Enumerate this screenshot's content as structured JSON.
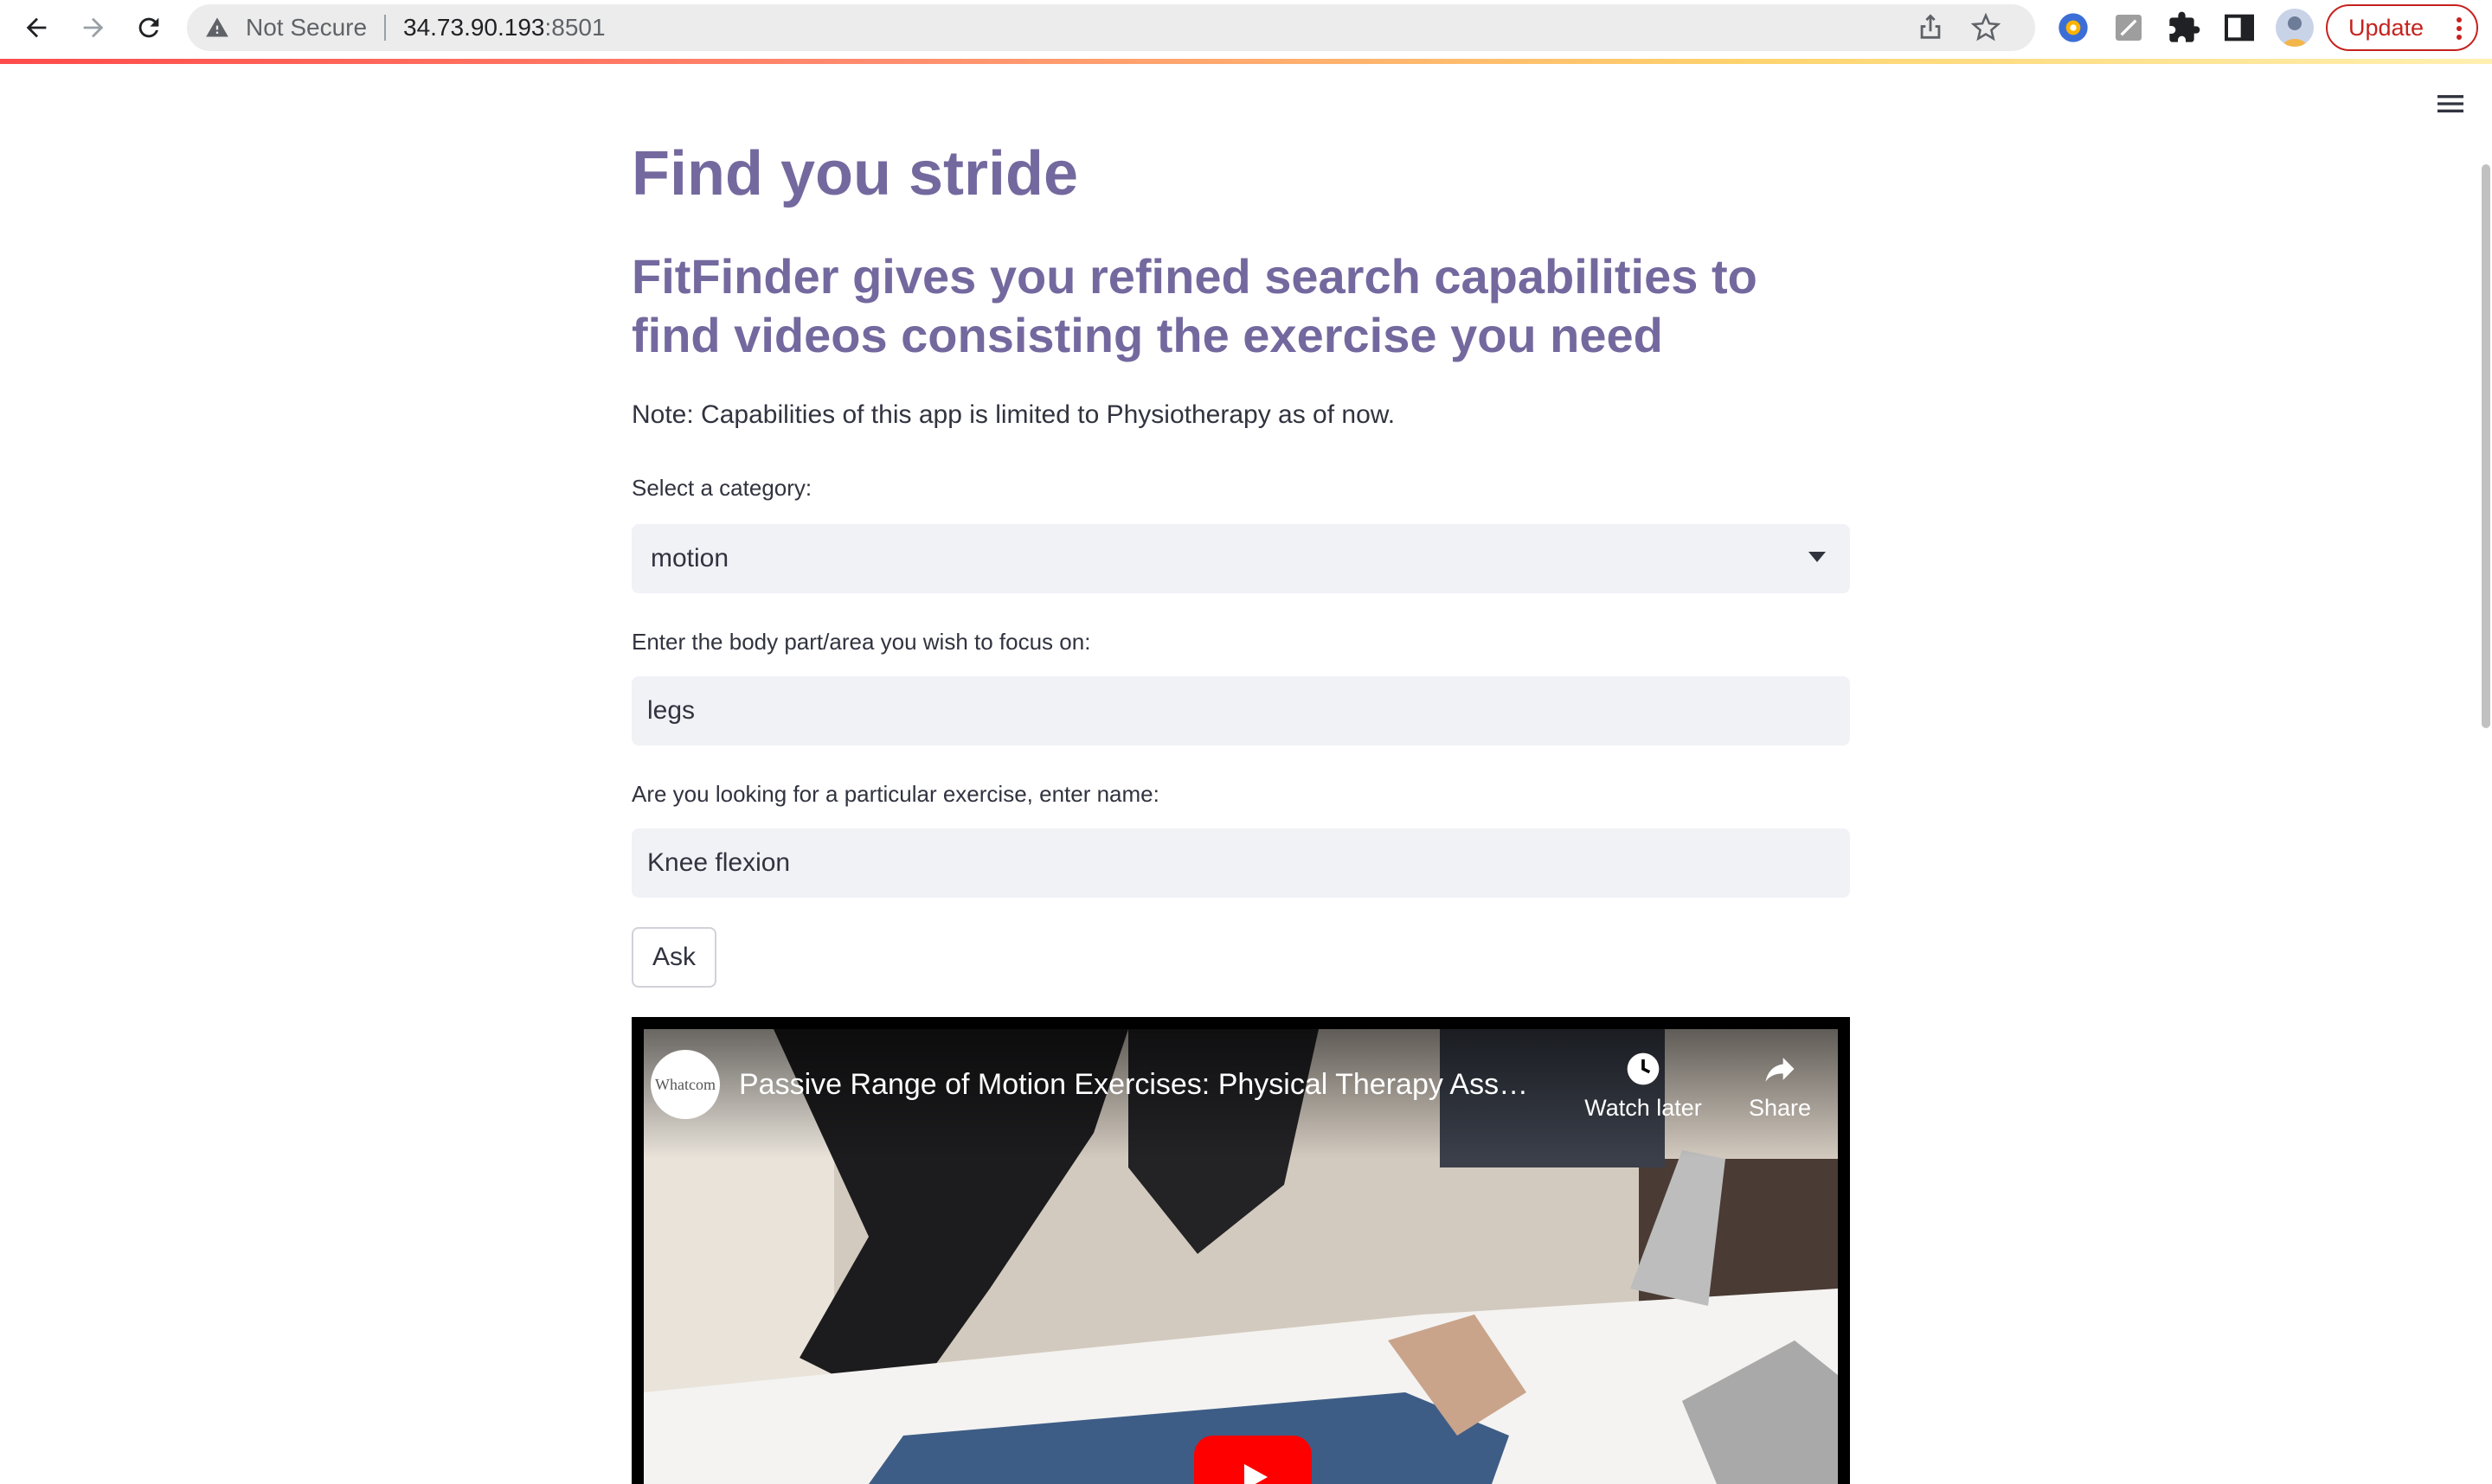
{
  "browser": {
    "security_text": "Not Secure",
    "url_host": "34.73.90.193",
    "url_port": ":8501",
    "update_label": "Update"
  },
  "app": {
    "title": "Find you stride",
    "subtitle": "FitFinder gives you refined search capabilities to find videos consisting the exercise you need",
    "note": "Note: Capabilities of this app is limited to Physiotherapy as of now.",
    "category": {
      "label": "Select a category:",
      "selected": "motion"
    },
    "body_part": {
      "label": "Enter the body part/area you wish to focus on:",
      "value": "legs"
    },
    "exercise": {
      "label": "Are you looking for a particular exercise, enter name:",
      "value": "Knee flexion"
    },
    "ask_label": "Ask"
  },
  "video": {
    "channel_logo_text": "Whatcom",
    "title": "Passive Range of Motion Exercises: Physical Therapy Ass…",
    "watch_later_label": "Watch later",
    "share_label": "Share"
  },
  "colors": {
    "heading": "#74699e",
    "input_bg": "#f0f2f6",
    "update_red": "#c5221f",
    "play_red": "#ff0000"
  }
}
